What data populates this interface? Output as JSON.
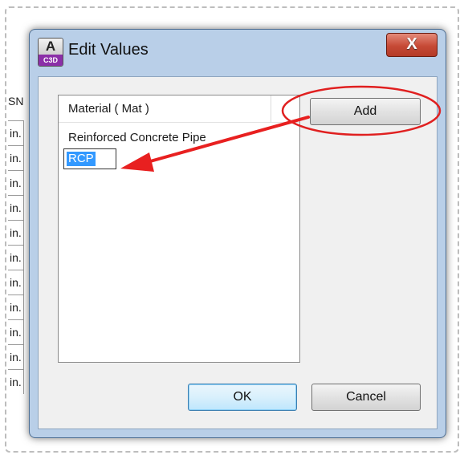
{
  "background": {
    "header_fragment": "SN",
    "column_cells": [
      "in.",
      "in.",
      "in.",
      "in.",
      "in.",
      "in.",
      "in.",
      "in.",
      "in.",
      "in.",
      "in."
    ]
  },
  "dialog": {
    "title": "Edit Values",
    "app_icon_letter": "A",
    "app_icon_badge": "C3D",
    "close_symbol": "X",
    "list": {
      "column_header": "Material ( Mat )",
      "items": [
        "Reinforced Concrete Pipe"
      ],
      "edit_value": "RCP"
    },
    "buttons": {
      "add": "Add",
      "ok": "OK",
      "cancel": "Cancel"
    }
  },
  "annotation_colors": {
    "circle": "#e02020",
    "arrow": "#e82020"
  }
}
